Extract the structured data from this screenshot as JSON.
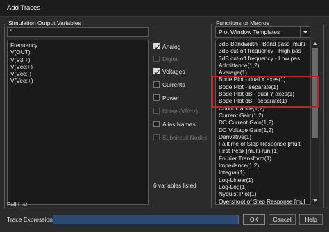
{
  "window": {
    "title": "Add Traces"
  },
  "sim_vars": {
    "group_label": "Simulation Output Variables",
    "filter_value": "*",
    "items": [
      "Frequency",
      "V(OUT)",
      "V(V3:+)",
      "V(Vcc:+)",
      "V(Vcc:-)",
      "V(Vee:+)"
    ],
    "count_text": "6 variables listed",
    "full_list_label": "Full List"
  },
  "filters": [
    {
      "label": "Analog",
      "checked": true,
      "enabled": true
    },
    {
      "label": "Digital",
      "checked": false,
      "enabled": false
    },
    {
      "label": "Voltages",
      "checked": true,
      "enabled": true
    },
    {
      "label": "Currents",
      "checked": false,
      "enabled": true
    },
    {
      "label": "Power",
      "checked": false,
      "enabled": true
    },
    {
      "label": "Noise (V²/Hz)",
      "checked": false,
      "enabled": false
    },
    {
      "label": "Alias Names",
      "checked": false,
      "enabled": true
    },
    {
      "label": "Subcircuit Nodes",
      "checked": false,
      "enabled": false
    }
  ],
  "functions": {
    "group_label": "Functions or Macros",
    "dropdown_value": "Plot Window Templates",
    "items": [
      "3dB Bandwidth - Band pass [multi-",
      "3dB cut-off frequency - High pas",
      "3dB cut-off frequency - Low pas",
      "Admittance(1,2)",
      "Average(1)",
      "Bode Plot - dual Y axes(1)",
      "Bode Plot - separate(1)",
      "Bode Plot dB - dual Y axes(1)",
      "Bode Plot dB - separate(1)",
      "Conductance(1,2)",
      "Current Gain(1,2)",
      "DC Current Gain(1,2)",
      "DC Voltage Gain(1,2)",
      "Derivative(1)",
      "Falltime of Step Response [multi",
      "First Peak [multi-run](1)",
      "Fourier Transform(1)",
      "Impedance(1,2)",
      "Integral(1)",
      "Log-Linear(1)",
      "Log-Log(1)",
      "Nyquist Plot(1)",
      "Overshoot of Step Response [mul"
    ],
    "highlight_color": "#e0141f"
  },
  "footer": {
    "trace_label": "Trace Expression:",
    "trace_value": "",
    "ok_label": "OK",
    "cancel_label": "Cancel",
    "help_label": "Help"
  }
}
